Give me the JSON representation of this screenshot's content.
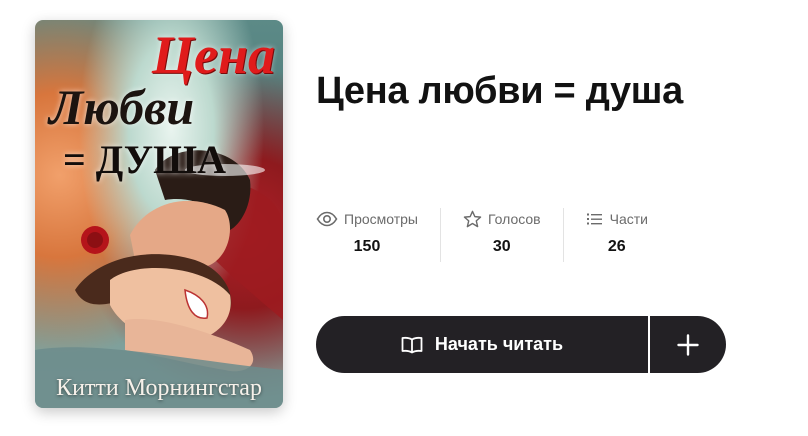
{
  "cover": {
    "title_line1": "Цена",
    "title_line2": "Любви",
    "title_line3": "= ДУША",
    "author": "Китти Морнингстар"
  },
  "book": {
    "title": "Цена любви = душа"
  },
  "stats": {
    "views": {
      "icon": "eye-icon",
      "label": "Просмотры",
      "value": "150"
    },
    "votes": {
      "icon": "star-icon",
      "label": "Голосов",
      "value": "30"
    },
    "parts": {
      "icon": "list-icon",
      "label": "Части",
      "value": "26"
    }
  },
  "actions": {
    "read_icon": "open-book-icon",
    "read_label": "Начать читать",
    "add_icon": "plus-icon"
  },
  "colors": {
    "button_bg": "#232125",
    "button_text": "#ffffff",
    "cover_title_red": "#e01b1b",
    "label_gray": "#6b6b6b",
    "text_dark": "#121212"
  }
}
